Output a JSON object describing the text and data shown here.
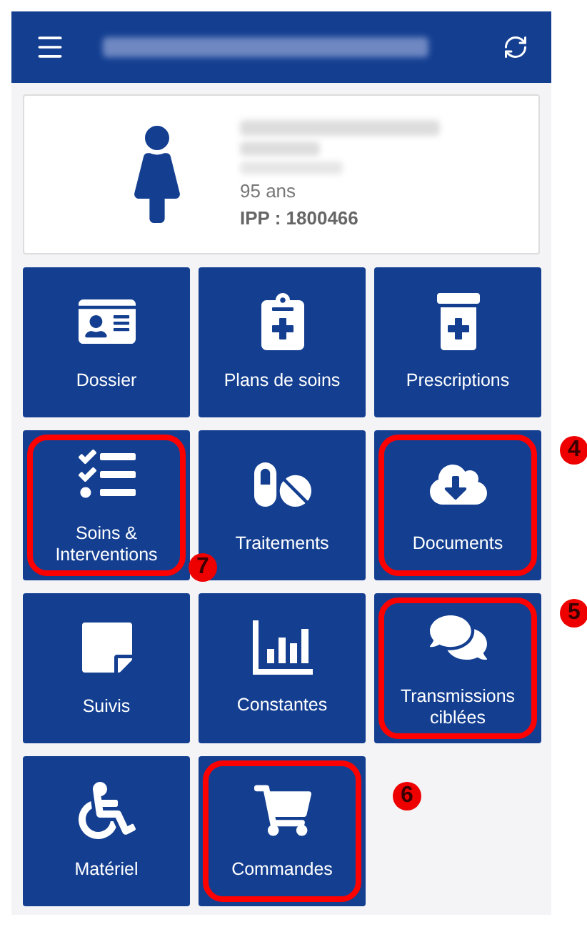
{
  "patient": {
    "age": "95 ans",
    "ipp": "IPP : 1800466"
  },
  "tiles": [
    {
      "label": "Dossier",
      "highlighted": false
    },
    {
      "label": "Plans de soins",
      "highlighted": false
    },
    {
      "label": "Prescriptions",
      "highlighted": false
    },
    {
      "label": "Soins &\nInterventions",
      "highlighted": true,
      "callout": "7"
    },
    {
      "label": "Traitements",
      "highlighted": false
    },
    {
      "label": "Documents",
      "highlighted": true,
      "callout": "4"
    },
    {
      "label": "Suivis",
      "highlighted": false
    },
    {
      "label": "Constantes",
      "highlighted": false
    },
    {
      "label": "Transmissions\nciblées",
      "highlighted": true,
      "callout": "5"
    },
    {
      "label": "Matériel",
      "highlighted": false
    },
    {
      "label": "Commandes",
      "highlighted": true,
      "callout": "6"
    }
  ]
}
